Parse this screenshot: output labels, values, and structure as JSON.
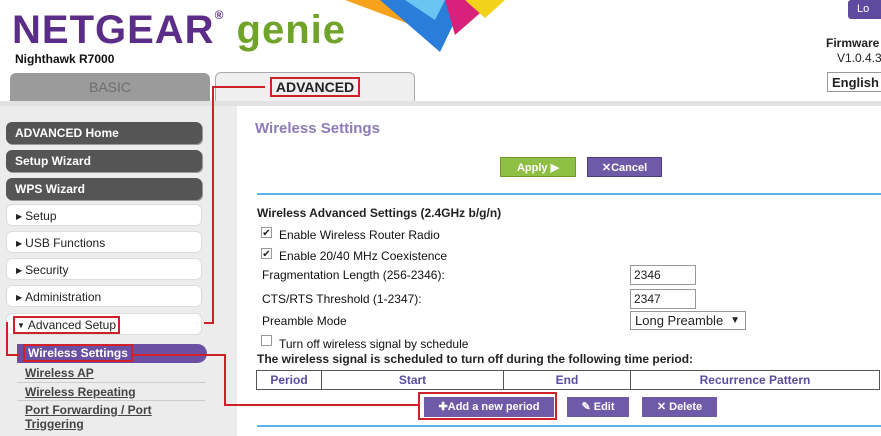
{
  "header": {
    "brand": "NETGEAR",
    "reg": "®",
    "product": "genie",
    "model": "Nighthawk R7000",
    "logout_label": "Lo",
    "firmware_label": "Firmware",
    "firmware_version": "V1.0.4.3",
    "language": "English"
  },
  "tabs": {
    "basic": "BASIC",
    "advanced": "ADVANCED"
  },
  "sidebar": {
    "dark_items": [
      "ADVANCED Home",
      "Setup Wizard",
      "WPS Wizard"
    ],
    "light_items": [
      "Setup",
      "USB Functions",
      "Security",
      "Administration"
    ],
    "advanced_setup": "Advanced Setup",
    "active_item": "Wireless Settings",
    "sub_items": [
      "Wireless AP",
      "Wireless Repeating",
      "Port Forwarding / Port",
      "Triggering"
    ]
  },
  "main": {
    "title": "Wireless Settings",
    "apply_label": "Apply ▶",
    "cancel_label": "Cancel",
    "section_title": "Wireless Advanced Settings (2.4GHz b/g/n)",
    "enable_radio_label": "Enable Wireless Router Radio",
    "enable_coexist_label": "Enable 20/40 MHz Coexistence",
    "frag_label": "Fragmentation Length (256-2346):",
    "frag_value": "2346",
    "cts_label": "CTS/RTS Threshold (1-2347):",
    "cts_value": "2347",
    "preamble_label": "Preamble Mode",
    "preamble_value": "Long Preamble",
    "schedule_label": "Turn off wireless signal by schedule",
    "schedule_text": "The wireless signal is scheduled to turn off during the following time period:",
    "table_headers": [
      "Period",
      "Start",
      "End",
      "Recurrence Pattern"
    ],
    "add_label": "Add a new period",
    "edit_label": "Edit",
    "delete_label": "Delete"
  },
  "colors": {
    "brand_purple": "#5b2c88",
    "genie_green": "#6fa32a",
    "button_purple": "#6f5aa8",
    "apply_green": "#8fbf45",
    "highlight_red": "#d0202a",
    "rule_blue": "#5bb5e5"
  }
}
